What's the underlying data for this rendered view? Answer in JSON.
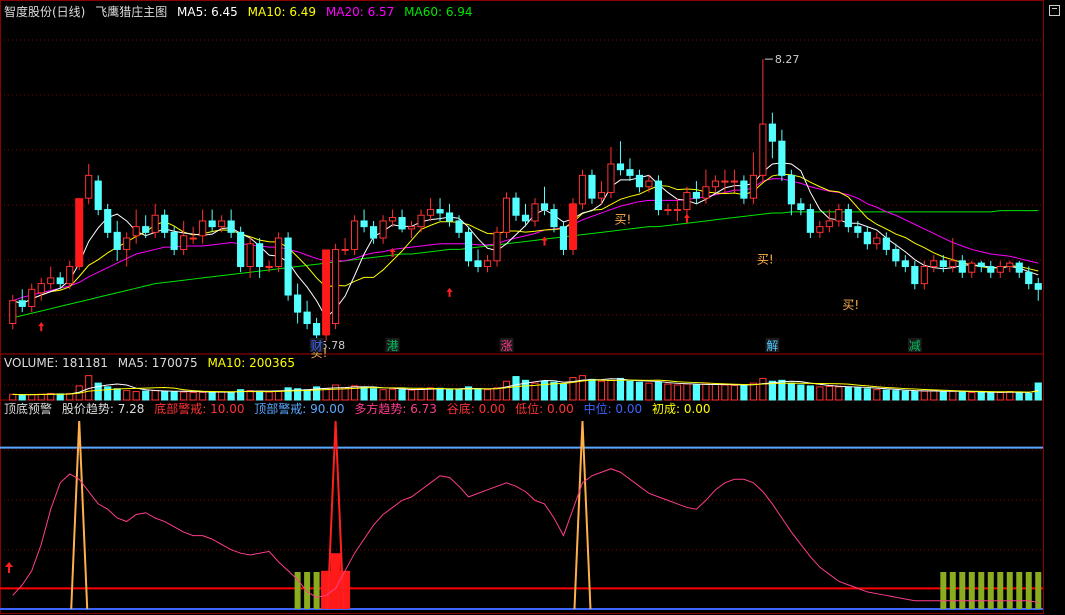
{
  "main_header": {
    "stock": "智度股份(日线)",
    "indicator": "飞鹰猎庄主图",
    "ma5": "MA5: 6.45",
    "ma10": "MA10: 6.49",
    "ma20": "MA20: 6.57",
    "ma60": "MA60: 6.94"
  },
  "volume_header": {
    "volume": "VOLUME: 181181",
    "ma5": "MA5: 170075",
    "ma10": "MA10: 200365"
  },
  "sub_header": {
    "name": "顶底预警",
    "trend": "股价趋势: 7.28",
    "bottom_warn": "底部警戒: 10.00",
    "top_warn": "顶部警戒: 90.00",
    "bull": "多方趋势: 6.73",
    "valley": "谷底: 0.00",
    "low": "低位: 0.00",
    "mid": "中位: 0.00",
    "initial": "初成: 0.00"
  },
  "annotations": {
    "high_label": "8.27",
    "low_label": "5.78",
    "buy": "买!"
  },
  "news_tags": [
    "财",
    "港",
    "涨",
    "解",
    "减"
  ],
  "colors": {
    "up": "#ff3232",
    "down": "#54ffff",
    "ma5": "#ffffff",
    "ma10": "#ffff00",
    "ma20": "#ff00ff",
    "ma60": "#00e600",
    "grid": "#8b0000",
    "top_line": "#5aa8ff",
    "bottom_line": "#ff0000",
    "trend_line": "#ff3c8c",
    "spike": "#ffb04c",
    "bar_green": "#8aac1e"
  },
  "chart_data": {
    "type": "candlestick",
    "main_price_range": [
      5.7,
      8.35
    ],
    "candles": [
      [
        5.95,
        6.15,
        5.9,
        6.2
      ],
      [
        6.15,
        6.1,
        6.05,
        6.25
      ],
      [
        6.1,
        6.25,
        6.05,
        6.3
      ],
      [
        6.22,
        6.3,
        6.15,
        6.35
      ],
      [
        6.3,
        6.35,
        6.25,
        6.45
      ],
      [
        6.35,
        6.3,
        6.25,
        6.4
      ],
      [
        6.3,
        6.45,
        6.25,
        6.5
      ],
      [
        6.45,
        7.0,
        6.42,
        7.05
      ],
      [
        7.05,
        7.25,
        7.0,
        7.35
      ],
      [
        7.2,
        6.95,
        6.9,
        7.25
      ],
      [
        6.95,
        6.75,
        6.7,
        7.0
      ],
      [
        6.75,
        6.6,
        6.5,
        6.85
      ],
      [
        6.6,
        6.7,
        6.45,
        6.75
      ],
      [
        6.72,
        6.8,
        6.65,
        6.95
      ],
      [
        6.8,
        6.75,
        6.7,
        6.9
      ],
      [
        6.75,
        6.9,
        6.7,
        7.0
      ],
      [
        6.9,
        6.75,
        6.7,
        6.95
      ],
      [
        6.75,
        6.6,
        6.55,
        6.8
      ],
      [
        6.6,
        6.72,
        6.55,
        6.85
      ],
      [
        6.7,
        6.7,
        6.65,
        6.8
      ],
      [
        6.72,
        6.85,
        6.65,
        6.95
      ],
      [
        6.85,
        6.8,
        6.75,
        6.95
      ],
      [
        6.8,
        6.85,
        6.75,
        6.9
      ],
      [
        6.85,
        6.75,
        6.7,
        6.95
      ],
      [
        6.75,
        6.45,
        6.4,
        6.8
      ],
      [
        6.45,
        6.65,
        6.35,
        6.7
      ],
      [
        6.65,
        6.45,
        6.35,
        6.7
      ],
      [
        6.45,
        6.45,
        6.4,
        6.5
      ],
      [
        6.45,
        6.7,
        6.4,
        6.75
      ],
      [
        6.7,
        6.2,
        6.15,
        6.75
      ],
      [
        6.2,
        6.05,
        5.95,
        6.3
      ],
      [
        6.05,
        5.95,
        5.9,
        6.15
      ],
      [
        5.95,
        5.85,
        5.78,
        6.0
      ],
      [
        5.85,
        5.95,
        5.8,
        6.0
      ],
      [
        5.95,
        6.6,
        5.9,
        6.65
      ],
      [
        6.6,
        6.6,
        6.55,
        6.7
      ],
      [
        6.6,
        6.85,
        6.55,
        6.9
      ],
      [
        6.85,
        6.8,
        6.75,
        6.95
      ],
      [
        6.8,
        6.7,
        6.65,
        6.85
      ],
      [
        6.7,
        6.85,
        6.65,
        6.9
      ],
      [
        6.85,
        6.88,
        6.8,
        6.95
      ],
      [
        6.88,
        6.78,
        6.75,
        6.95
      ],
      [
        6.78,
        6.8,
        6.7,
        6.85
      ],
      [
        6.8,
        6.9,
        6.75,
        6.95
      ],
      [
        6.9,
        6.95,
        6.85,
        7.05
      ],
      [
        6.95,
        6.92,
        6.85,
        7.05
      ],
      [
        6.92,
        6.85,
        6.8,
        7.0
      ],
      [
        6.85,
        6.75,
        6.7,
        6.9
      ],
      [
        6.75,
        6.5,
        6.45,
        6.8
      ],
      [
        6.5,
        6.45,
        6.4,
        6.6
      ],
      [
        6.45,
        6.5,
        6.4,
        6.55
      ],
      [
        6.5,
        6.75,
        6.45,
        6.8
      ],
      [
        6.75,
        7.05,
        6.7,
        7.1
      ],
      [
        7.05,
        6.9,
        6.85,
        7.1
      ],
      [
        6.9,
        6.85,
        6.8,
        7.0
      ],
      [
        6.85,
        7.0,
        6.8,
        7.05
      ],
      [
        7.0,
        6.95,
        6.9,
        7.15
      ],
      [
        6.95,
        6.8,
        6.75,
        7.0
      ],
      [
        6.8,
        6.6,
        6.55,
        6.85
      ],
      [
        6.6,
        7.0,
        6.55,
        7.05
      ],
      [
        7.0,
        7.25,
        6.95,
        7.3
      ],
      [
        7.25,
        7.05,
        7.0,
        7.3
      ],
      [
        7.05,
        7.1,
        7.0,
        7.2
      ],
      [
        7.1,
        7.35,
        7.05,
        7.5
      ],
      [
        7.35,
        7.3,
        7.25,
        7.55
      ],
      [
        7.3,
        7.25,
        7.2,
        7.4
      ],
      [
        7.25,
        7.15,
        7.1,
        7.3
      ],
      [
        7.15,
        7.2,
        7.1,
        7.25
      ],
      [
        7.2,
        6.95,
        6.9,
        7.25
      ],
      [
        6.95,
        6.95,
        6.9,
        7.0
      ],
      [
        6.95,
        6.95,
        6.85,
        7.05
      ],
      [
        6.95,
        7.1,
        6.9,
        7.15
      ],
      [
        7.1,
        7.05,
        7.0,
        7.2
      ],
      [
        7.05,
        7.15,
        7.0,
        7.3
      ],
      [
        7.15,
        7.2,
        7.1,
        7.25
      ],
      [
        7.2,
        7.2,
        7.1,
        7.3
      ],
      [
        7.2,
        7.2,
        7.1,
        7.3
      ],
      [
        7.2,
        7.05,
        7.0,
        7.25
      ],
      [
        7.05,
        7.25,
        7.0,
        7.45
      ],
      [
        7.25,
        7.7,
        7.2,
        8.27
      ],
      [
        7.7,
        7.55,
        7.4,
        7.8
      ],
      [
        7.55,
        7.25,
        7.2,
        7.65
      ],
      [
        7.25,
        7.0,
        6.9,
        7.3
      ],
      [
        7.0,
        6.95,
        6.9,
        7.05
      ],
      [
        6.95,
        6.75,
        6.7,
        7.0
      ],
      [
        6.75,
        6.8,
        6.7,
        6.85
      ],
      [
        6.8,
        6.85,
        6.75,
        6.95
      ],
      [
        6.85,
        6.95,
        6.8,
        7.0
      ],
      [
        6.95,
        6.8,
        6.75,
        7.0
      ],
      [
        6.8,
        6.75,
        6.7,
        6.85
      ],
      [
        6.75,
        6.65,
        6.6,
        6.8
      ],
      [
        6.65,
        6.7,
        6.6,
        6.75
      ],
      [
        6.7,
        6.6,
        6.55,
        6.75
      ],
      [
        6.6,
        6.5,
        6.45,
        6.65
      ],
      [
        6.5,
        6.45,
        6.4,
        6.55
      ],
      [
        6.45,
        6.3,
        6.25,
        6.5
      ],
      [
        6.3,
        6.45,
        6.25,
        6.5
      ],
      [
        6.45,
        6.5,
        6.4,
        6.55
      ],
      [
        6.5,
        6.45,
        6.4,
        6.55
      ],
      [
        6.45,
        6.5,
        6.4,
        6.7
      ],
      [
        6.5,
        6.4,
        6.35,
        6.55
      ],
      [
        6.4,
        6.48,
        6.35,
        6.5
      ],
      [
        6.48,
        6.45,
        6.4,
        6.5
      ],
      [
        6.45,
        6.4,
        6.35,
        6.5
      ],
      [
        6.4,
        6.45,
        6.35,
        6.5
      ],
      [
        6.45,
        6.48,
        6.4,
        6.5
      ],
      [
        6.48,
        6.4,
        6.35,
        6.5
      ],
      [
        6.4,
        6.3,
        6.25,
        6.45
      ],
      [
        6.3,
        6.25,
        6.15,
        6.35
      ]
    ],
    "ma60": [
      6.0,
      6.02,
      6.04,
      6.06,
      6.08,
      6.1,
      6.12,
      6.14,
      6.16,
      6.18,
      6.2,
      6.22,
      6.24,
      6.26,
      6.28,
      6.3,
      6.31,
      6.32,
      6.33,
      6.34,
      6.35,
      6.36,
      6.37,
      6.38,
      6.39,
      6.4,
      6.41,
      6.42,
      6.43,
      6.44,
      6.45,
      6.46,
      6.47,
      6.48,
      6.49,
      6.5,
      6.51,
      6.52,
      6.53,
      6.54,
      6.55,
      6.56,
      6.56,
      6.57,
      6.58,
      6.59,
      6.6,
      6.6,
      6.61,
      6.62,
      6.63,
      6.64,
      6.65,
      6.66,
      6.67,
      6.68,
      6.69,
      6.7,
      6.71,
      6.72,
      6.73,
      6.74,
      6.75,
      6.76,
      6.77,
      6.78,
      6.79,
      6.8,
      6.8,
      6.81,
      6.82,
      6.83,
      6.84,
      6.85,
      6.86,
      6.87,
      6.88,
      6.89,
      6.9,
      6.91,
      6.92,
      6.92,
      6.93,
      6.93,
      6.93,
      6.93,
      6.93,
      6.93,
      6.93,
      6.93,
      6.93,
      6.93,
      6.93,
      6.93,
      6.93,
      6.93,
      6.93,
      6.93,
      6.93,
      6.93,
      6.93,
      6.93,
      6.93,
      6.93,
      6.94,
      6.94,
      6.94,
      6.94,
      6.94
    ],
    "ma20": [
      6.15,
      6.18,
      6.2,
      6.22,
      6.24,
      6.26,
      6.28,
      6.31,
      6.36,
      6.4,
      6.44,
      6.48,
      6.52,
      6.56,
      6.58,
      6.6,
      6.62,
      6.62,
      6.63,
      6.63,
      6.63,
      6.64,
      6.65,
      6.66,
      6.65,
      6.64,
      6.63,
      6.62,
      6.62,
      6.6,
      6.58,
      6.55,
      6.52,
      6.5,
      6.5,
      6.5,
      6.52,
      6.55,
      6.57,
      6.58,
      6.6,
      6.61,
      6.62,
      6.63,
      6.64,
      6.65,
      6.65,
      6.65,
      6.65,
      6.64,
      6.64,
      6.65,
      6.68,
      6.7,
      6.72,
      6.74,
      6.77,
      6.78,
      6.79,
      6.82,
      6.86,
      6.89,
      6.92,
      6.95,
      6.98,
      7.0,
      7.02,
      7.03,
      7.03,
      7.03,
      7.03,
      7.04,
      7.05,
      7.06,
      7.08,
      7.1,
      7.12,
      7.12,
      7.14,
      7.2,
      7.22,
      7.22,
      7.2,
      7.18,
      7.15,
      7.13,
      7.11,
      7.1,
      7.08,
      7.05,
      7.0,
      6.97,
      6.93,
      6.9,
      6.86,
      6.82,
      6.78,
      6.74,
      6.7,
      6.66,
      6.63,
      6.6,
      6.58,
      6.56,
      6.55,
      6.54,
      6.52,
      6.5,
      6.48
    ],
    "volume_range": [
      0,
      320000
    ],
    "volume": [
      60000,
      55000,
      58000,
      62000,
      70000,
      65000,
      68000,
      150000,
      260000,
      180000,
      140000,
      120000,
      100000,
      90000,
      95000,
      100000,
      95000,
      90000,
      85000,
      80000,
      82000,
      88000,
      86000,
      84000,
      110000,
      100000,
      95000,
      85000,
      95000,
      130000,
      120000,
      110000,
      140000,
      120000,
      160000,
      130000,
      150000,
      140000,
      120000,
      110000,
      115000,
      110000,
      105000,
      120000,
      130000,
      125000,
      115000,
      110000,
      140000,
      120000,
      110000,
      130000,
      200000,
      250000,
      210000,
      180000,
      200000,
      190000,
      170000,
      240000,
      260000,
      220000,
      200000,
      210000,
      230000,
      200000,
      190000,
      180000,
      190000,
      170000,
      160000,
      170000,
      160000,
      170000,
      165000,
      160000,
      155000,
      150000,
      180000,
      230000,
      200000,
      210000,
      180000,
      160000,
      150000,
      140000,
      145000,
      140000,
      135000,
      130000,
      120000,
      110000,
      105000,
      100000,
      95000,
      90000,
      95000,
      100000,
      90000,
      95000,
      85000,
      80000,
      85000,
      75000,
      80000,
      90000,
      85000,
      70000,
      181181
    ],
    "osc_range": [
      0,
      100
    ],
    "trend": [
      6,
      12,
      20,
      35,
      55,
      70,
      75,
      72,
      65,
      58,
      55,
      50,
      48,
      52,
      53,
      50,
      48,
      45,
      42,
      40,
      40,
      38,
      35,
      32,
      30,
      29,
      30,
      31,
      25,
      20,
      15,
      8,
      5,
      6,
      10,
      20,
      30,
      38,
      46,
      52,
      56,
      60,
      62,
      66,
      70,
      74,
      73,
      68,
      62,
      64,
      66,
      68,
      70,
      68,
      65,
      60,
      58,
      50,
      40,
      55,
      70,
      74,
      76,
      78,
      76,
      72,
      68,
      64,
      62,
      60,
      58,
      56,
      55,
      60,
      66,
      70,
      72,
      72,
      70,
      65,
      58,
      50,
      42,
      35,
      28,
      22,
      18,
      14,
      12,
      10,
      8,
      7,
      6,
      5,
      4,
      3,
      3,
      3,
      3,
      3,
      3,
      3,
      3,
      3,
      3,
      3,
      3,
      3,
      2
    ],
    "top_warning": 90,
    "bottom_warning": 10,
    "spikes": [
      7,
      34,
      60
    ],
    "red_bars": [
      [
        33,
        20
      ],
      [
        34,
        30
      ],
      [
        35,
        20
      ]
    ],
    "green_bar_start": 98
  }
}
